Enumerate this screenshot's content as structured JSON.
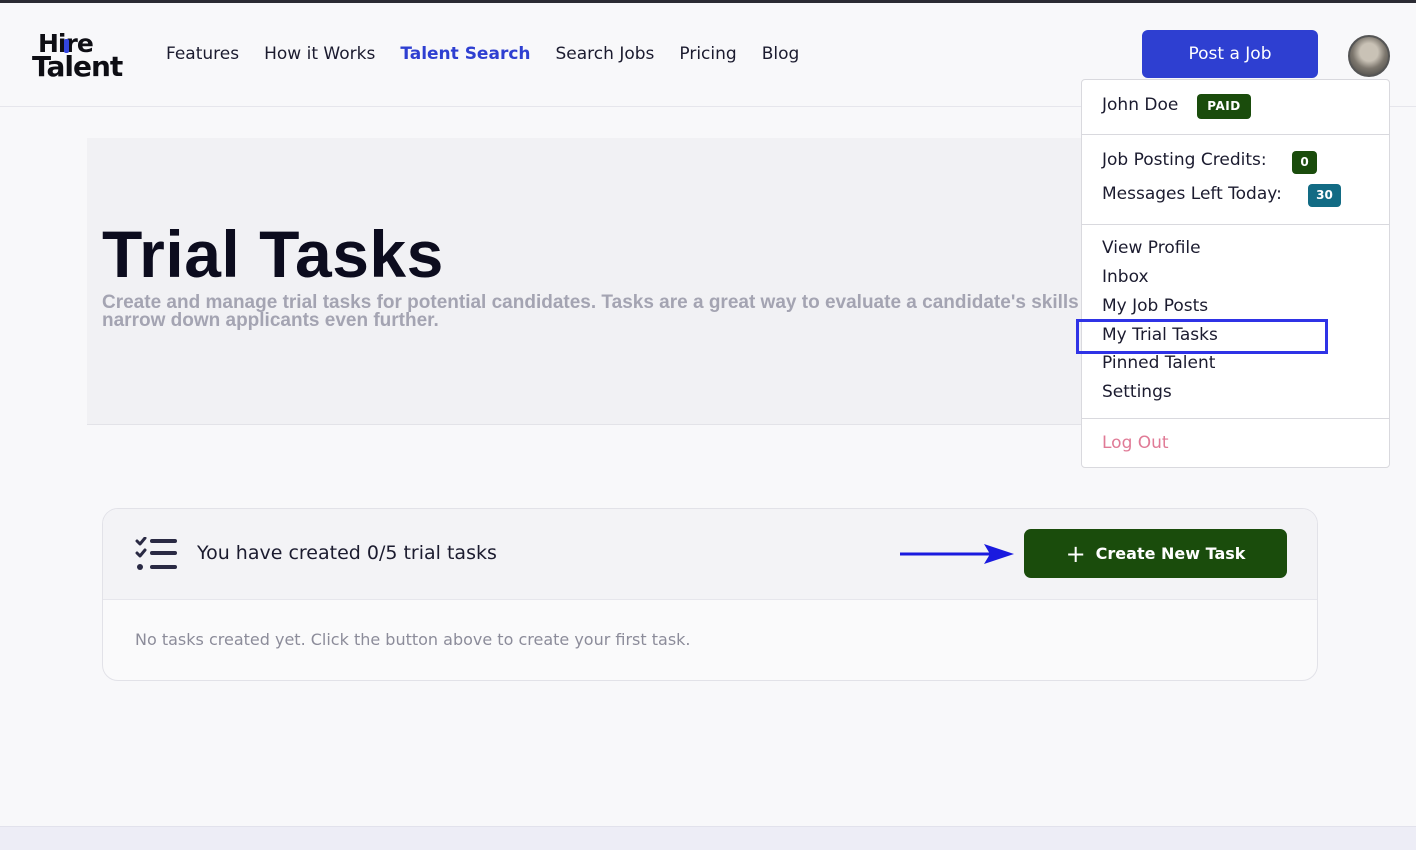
{
  "header": {
    "logo_line1": "Hire",
    "logo_line2": "Talent",
    "nav": [
      {
        "label": "Features"
      },
      {
        "label": "How it Works"
      },
      {
        "label": "Talent Search",
        "active": true
      },
      {
        "label": "Search Jobs"
      },
      {
        "label": "Pricing"
      },
      {
        "label": "Blog"
      }
    ],
    "post_job_label": "Post a Job"
  },
  "hero": {
    "title": "Trial Tasks",
    "subtitle": "Create and manage trial tasks for potential candidates. Tasks are a great way to evaluate a candidate's skills for a role to narrow down applicants even further."
  },
  "tasks_card": {
    "count_text": "You have created 0/5 trial tasks",
    "create_label": "Create New Task",
    "empty_text": "No tasks created yet. Click the button above to create your first task."
  },
  "user_menu": {
    "name": "John Doe",
    "plan_badge": "PAID",
    "credits_label": "Job Posting Credits:",
    "credits_value": "0",
    "messages_label": "Messages Left Today:",
    "messages_value": "30",
    "links": [
      "View Profile",
      "Inbox",
      "My Job Posts",
      "My Trial Tasks",
      "Pinned Talent",
      "Settings"
    ],
    "highlighted_link": "My Trial Tasks",
    "logout_label": "Log Out"
  },
  "colors": {
    "brand_blue": "#2e3fd1",
    "action_green": "#1a4c0c",
    "teal_badge": "#126b84",
    "logout_pink": "#e07a96",
    "annotation_blue": "#2f33e6"
  }
}
